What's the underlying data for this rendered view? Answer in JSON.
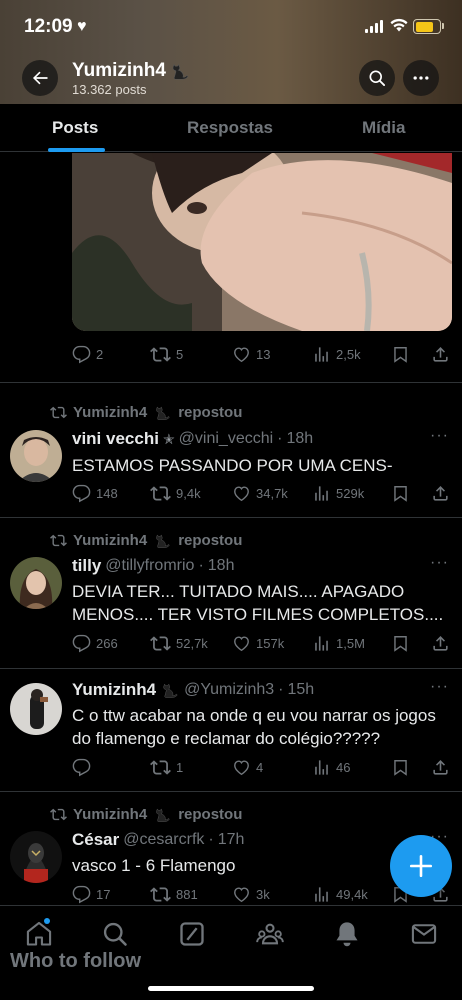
{
  "status_bar": {
    "time": "12:09"
  },
  "header": {
    "name": "Yumizinh4",
    "posts_count": "13.362 posts"
  },
  "tabs": [
    {
      "label": "Posts"
    },
    {
      "label": "Respostas"
    },
    {
      "label": "Mídia"
    }
  ],
  "first_post_actions": {
    "replies": "2",
    "reposts": "5",
    "likes": "13",
    "views": "2,5k"
  },
  "posts": [
    {
      "repost_label": "Yumizinh4",
      "repost_suffix": "repostou",
      "name": "vini vecchi",
      "handle": "@vini_vecchi",
      "time": "18h",
      "text": "ESTAMOS PASSANDO POR UMA CENS-",
      "replies": "148",
      "reposts": "9,4k",
      "likes": "34,7k",
      "views": "529k"
    },
    {
      "repost_label": "Yumizinh4",
      "repost_suffix": "repostou",
      "name": "tilly",
      "handle": "@tillyfromrio",
      "time": "18h",
      "text": "DEVIA TER... TUITADO MAIS.... APAGADO MENOS.... TER VISTO FILMES COMPLETOS....",
      "replies": "266",
      "reposts": "52,7k",
      "likes": "157k",
      "views": "1,5M"
    },
    {
      "name": "Yumizinh4",
      "handle": "@Yumizinh3",
      "time": "15h",
      "text": "C o ttw acabar na onde q eu vou narrar os jogos do flamengo e reclamar do colégio?????",
      "replies": "",
      "reposts": "1",
      "likes": "4",
      "views": "46"
    },
    {
      "repost_label": "Yumizinh4",
      "repost_suffix": "repostou",
      "name": "César",
      "handle": "@cesarcrfk",
      "time": "17h",
      "text": "vasco 1 - 6 Flamengo",
      "replies": "17",
      "reposts": "881",
      "likes": "3k",
      "views": "49,4k"
    }
  ],
  "bottom_nav": {
    "who_to_follow": "Who to follow"
  },
  "colors": {
    "accent": "#1d9bf0",
    "muted": "#71767b",
    "text": "#e7e9ea",
    "background": "#000000",
    "divider": "#2f3336"
  }
}
